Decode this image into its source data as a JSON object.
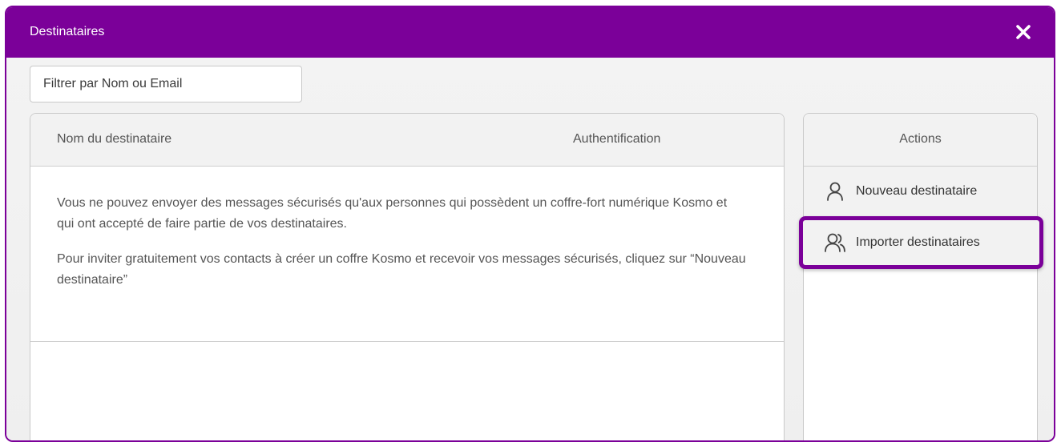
{
  "dialog": {
    "title": "Destinataires",
    "close_icon": "close-icon"
  },
  "filter": {
    "placeholder": "Filtrer par Nom ou Email",
    "value": ""
  },
  "table": {
    "columns": [
      "Nom du destinataire",
      "Authentification"
    ],
    "empty_message": [
      "Vous ne pouvez envoyer des messages sécurisés qu'aux personnes qui possèdent un coffre-fort numérique Kosmo et qui ont accepté de faire partie de vos destinataires.",
      "Pour inviter gratuitement vos contacts à créer un coffre Kosmo et recevoir vos messages sécurisés, cliquez sur “Nouveau destinataire”"
    ]
  },
  "actions": {
    "title": "Actions",
    "items": [
      {
        "label": "Nouveau destinataire",
        "icon": "user-icon"
      },
      {
        "label": "Importer destinataires",
        "icon": "users-icon",
        "highlighted": true
      }
    ]
  },
  "colors": {
    "brand": "#7b0099",
    "panel_header": "#f2f2f2",
    "text": "#555555"
  }
}
